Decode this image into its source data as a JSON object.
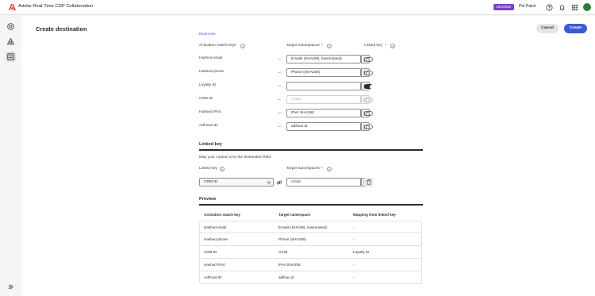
{
  "header": {
    "app_title": "Adobe Real-Time CDP Collaboration",
    "badge": "Advertiser",
    "org_name": "Pet Patch",
    "brand_color": "#e1251b",
    "badge_color": "#7b3fc4"
  },
  "page": {
    "title": "Create destination",
    "cancel_label": "Cancel",
    "create_label": "Create",
    "cut_link": "Read more",
    "primary_color": "#3d5ad3"
  },
  "activation": {
    "col_match_keys": "Activation match keys",
    "col_target_ns": "Target namespaces",
    "col_linked_key": "Linked key",
    "required_mark": "*",
    "rows": [
      {
        "key": "Hashed email",
        "namespace": "Emails (SHA256, lowercased)",
        "linked": false,
        "disabled": false
      },
      {
        "key": "Hashed phone",
        "namespace": "Phone (SHA256)",
        "linked": false,
        "disabled": false
      },
      {
        "key": "Loyalty ID",
        "namespace": "",
        "linked": true,
        "disabled": false
      },
      {
        "key": "CRM ID",
        "namespace": "crmid",
        "linked": false,
        "disabled": true
      },
      {
        "key": "Hashed IPv4",
        "namespace": "IPv4 SHA256",
        "linked": false,
        "disabled": false
      },
      {
        "key": "AdFixus ID",
        "namespace": "adfixus id",
        "linked": false,
        "disabled": false
      }
    ]
  },
  "linked_key": {
    "heading": "Linked key",
    "description": "Map your custom id to the destination field.",
    "label_linked_key": "Linked key",
    "label_target_ns": "Target namespaces",
    "selected_key": "CRM ID",
    "namespace": "crmid"
  },
  "preview": {
    "heading": "Preview",
    "columns": [
      "Activation match key",
      "Target namespace",
      "Mapping from linked key"
    ],
    "rows": [
      {
        "key": "Hashed email",
        "namespace": "Emails (SHA256, lowercased)",
        "mapping": "-"
      },
      {
        "key": "Hashed phone",
        "namespace": "Phone (SHA256)",
        "mapping": "-"
      },
      {
        "key": "CRM ID",
        "namespace": "crmid",
        "mapping": "Loyalty ID"
      },
      {
        "key": "Hashed IPv4",
        "namespace": "IPv4 SHA256",
        "mapping": "-"
      },
      {
        "key": "AdFixus ID",
        "namespace": "adfixus id",
        "mapping": "-"
      }
    ]
  }
}
